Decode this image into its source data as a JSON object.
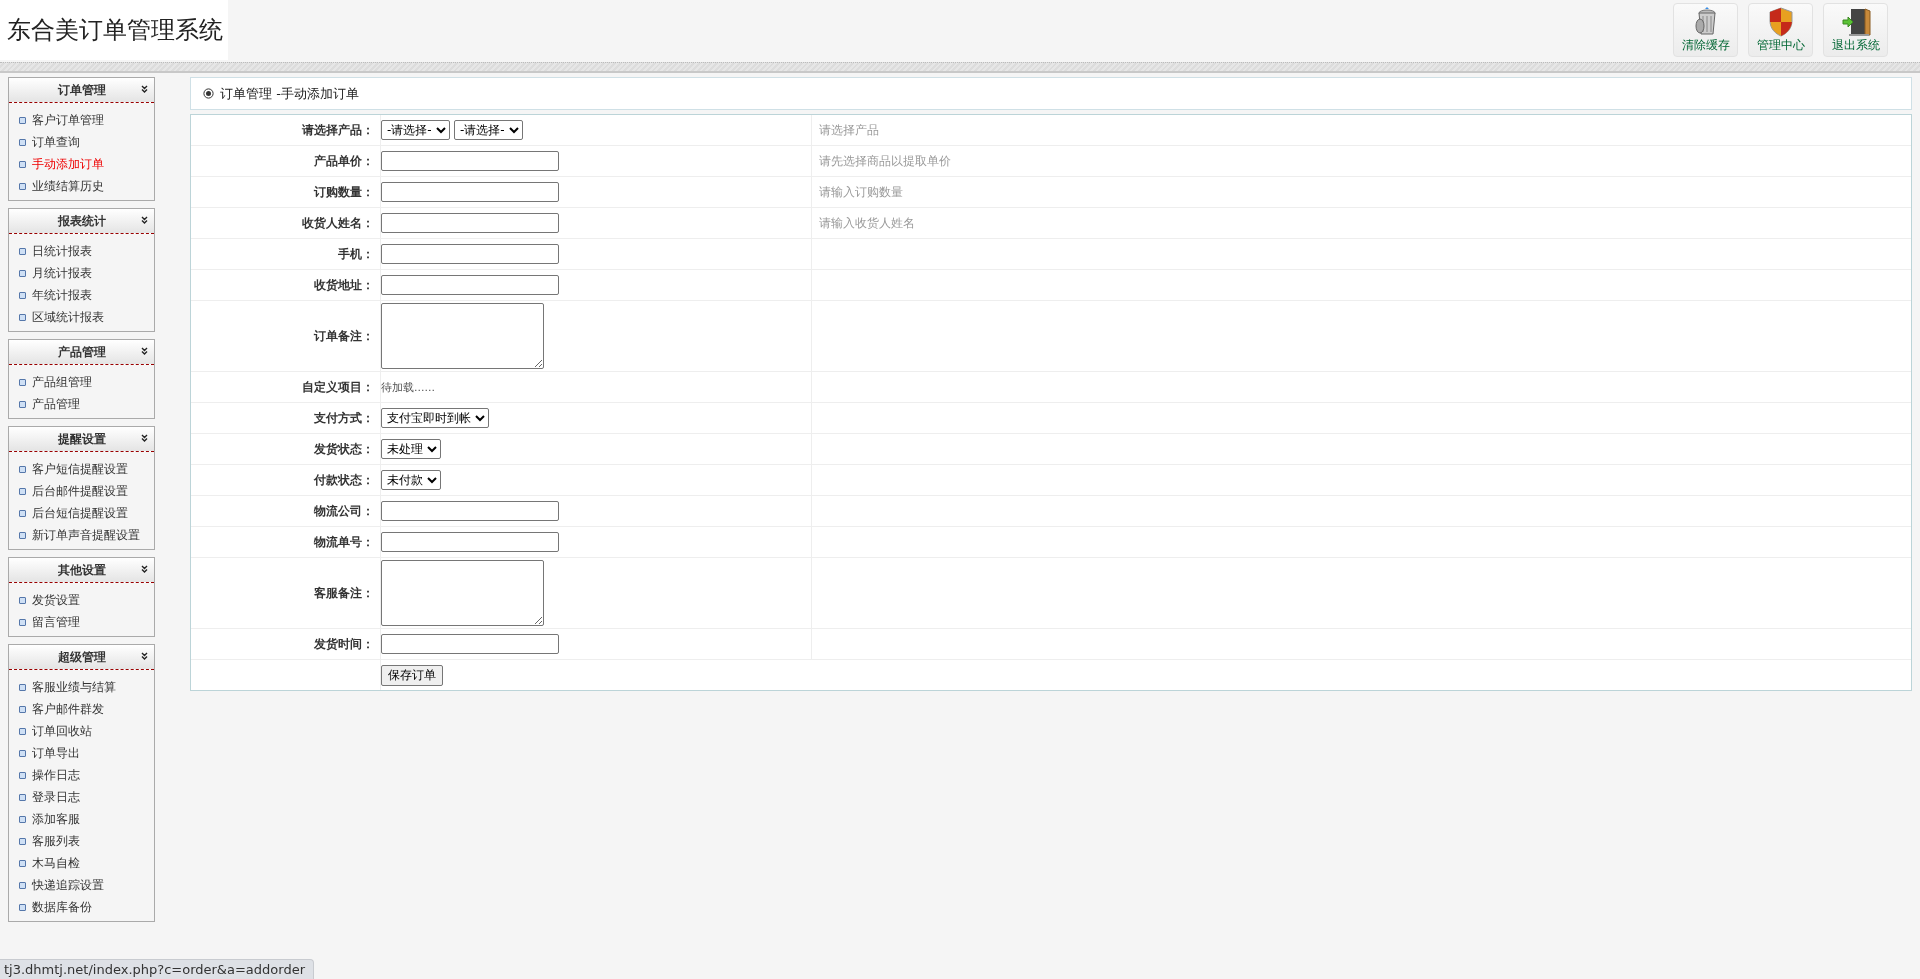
{
  "header": {
    "title": "东合美订单管理系统",
    "buttons": [
      {
        "kind": "trash",
        "label": "清除缓存"
      },
      {
        "kind": "shield",
        "label": "管理中心"
      },
      {
        "kind": "exit",
        "label": "退出系统"
      }
    ]
  },
  "sidebar": {
    "sections": [
      {
        "title": "订单管理",
        "items": [
          {
            "label": "客户订单管理",
            "selected": false
          },
          {
            "label": "订单查询",
            "selected": false
          },
          {
            "label": "手动添加订单",
            "selected": true
          },
          {
            "label": "业绩结算历史",
            "selected": false
          }
        ]
      },
      {
        "title": "报表统计",
        "items": [
          {
            "label": "日统计报表",
            "selected": false
          },
          {
            "label": "月统计报表",
            "selected": false
          },
          {
            "label": "年统计报表",
            "selected": false
          },
          {
            "label": "区域统计报表",
            "selected": false
          }
        ]
      },
      {
        "title": "产品管理",
        "items": [
          {
            "label": "产品组管理",
            "selected": false
          },
          {
            "label": "产品管理",
            "selected": false
          }
        ]
      },
      {
        "title": "提醒设置",
        "items": [
          {
            "label": "客户短信提醒设置",
            "selected": false
          },
          {
            "label": "后台邮件提醒设置",
            "selected": false
          },
          {
            "label": "后台短信提醒设置",
            "selected": false
          },
          {
            "label": "新订单声音提醒设置",
            "selected": false
          }
        ]
      },
      {
        "title": "其他设置",
        "items": [
          {
            "label": "发货设置",
            "selected": false
          },
          {
            "label": "留言管理",
            "selected": false
          }
        ]
      },
      {
        "title": "超级管理",
        "items": [
          {
            "label": "客服业绩与结算",
            "selected": false
          },
          {
            "label": "客户邮件群发",
            "selected": false
          },
          {
            "label": "订单回收站",
            "selected": false
          },
          {
            "label": "订单导出",
            "selected": false
          },
          {
            "label": "操作日志",
            "selected": false
          },
          {
            "label": "登录日志",
            "selected": false
          },
          {
            "label": "添加客服",
            "selected": false
          },
          {
            "label": "客服列表",
            "selected": false
          },
          {
            "label": "木马自检",
            "selected": false
          },
          {
            "label": "快递追踪设置",
            "selected": false
          },
          {
            "label": "数据库备份",
            "selected": false
          }
        ]
      }
    ]
  },
  "breadcrumb": "订单管理 -手动添加订单",
  "form": {
    "rows": [
      {
        "kind": "select",
        "label": "请选择产品：",
        "options": [
          "-请选择-",
          "-请选择-"
        ],
        "hint": "请选择产品"
      },
      {
        "kind": "input",
        "label": "产品单价：",
        "hint": "请先选择商品以提取单价"
      },
      {
        "kind": "input",
        "label": "订购数量：",
        "hint": "请输入订购数量"
      },
      {
        "kind": "input",
        "label": "收货人姓名：",
        "hint": "请输入收货人姓名"
      },
      {
        "kind": "input",
        "label": "手机："
      },
      {
        "kind": "input",
        "label": "收货地址："
      },
      {
        "kind": "textarea",
        "label": "订单备注："
      },
      {
        "kind": "text",
        "label": "自定义项目：",
        "value": "待加载......"
      },
      {
        "kind": "select",
        "label": "支付方式：",
        "options": [
          "支付宝即时到帐"
        ]
      },
      {
        "kind": "select",
        "label": "发货状态：",
        "options": [
          "未处理"
        ]
      },
      {
        "kind": "select",
        "label": "付款状态：",
        "options": [
          "未付款"
        ]
      },
      {
        "kind": "input",
        "label": "物流公司："
      },
      {
        "kind": "input",
        "label": "物流单号："
      },
      {
        "kind": "textarea",
        "label": "客服备注："
      },
      {
        "kind": "input",
        "label": "发货时间："
      }
    ],
    "submit": "保存订单"
  },
  "status_bar": "tj3.dhmtj.net/index.php?c=order&a=addorder"
}
